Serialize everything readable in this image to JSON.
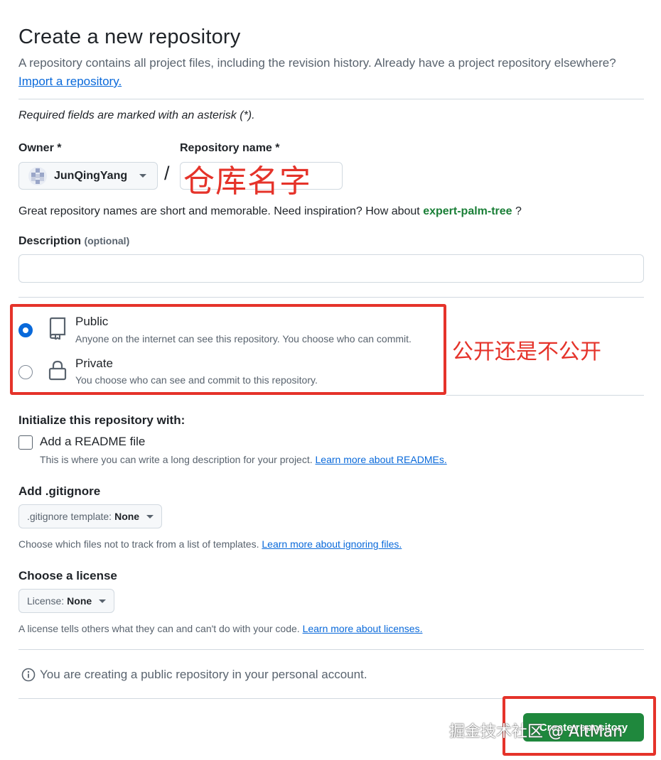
{
  "header": {
    "title": "Create a new repository",
    "subtitle": "A repository contains all project files, including the revision history. Already have a project repository elsewhere?",
    "import_link": "Import a repository."
  },
  "required_note": "Required fields are marked with an asterisk (*).",
  "owner": {
    "label": "Owner *",
    "value": "JunQingYang"
  },
  "separator": "/",
  "repository_name": {
    "label": "Repository name *",
    "value": "",
    "annotation": "仓库名字"
  },
  "inspiration": {
    "prefix": "Great repository names are short and memorable. Need inspiration? How about",
    "suggestion": "expert-palm-tree",
    "suffix": "?"
  },
  "description": {
    "label": "Description",
    "optional": "(optional)",
    "value": ""
  },
  "visibility": {
    "annotation": "公开还是不公开",
    "options": [
      {
        "title": "Public",
        "desc": "Anyone on the internet can see this repository. You choose who can commit.",
        "selected": true,
        "icon": "repo-icon"
      },
      {
        "title": "Private",
        "desc": "You choose who can see and commit to this repository.",
        "selected": false,
        "icon": "lock-icon"
      }
    ]
  },
  "initialize": {
    "title": "Initialize this repository with:",
    "readme_label": "Add a README file",
    "readme_checked": false,
    "readme_help": "This is where you can write a long description for your project.",
    "readme_link": "Learn more about READMEs."
  },
  "gitignore": {
    "title": "Add .gitignore",
    "select_prefix": ".gitignore template:",
    "select_value": "None",
    "help": "Choose which files not to track from a list of templates.",
    "link": "Learn more about ignoring files."
  },
  "license": {
    "title": "Choose a license",
    "select_prefix": "License:",
    "select_value": "None",
    "help": "A license tells others what they can and can't do with your code.",
    "link": "Learn more about licenses."
  },
  "info": {
    "text": "You are creating a public repository in your personal account.",
    "icon": "info-icon"
  },
  "submit": {
    "label": "Create repository"
  },
  "watermark": "掘金技术社区 @ AltMan",
  "colors": {
    "accent": "#0969da",
    "success": "#1f883d",
    "annotation": "#e5332a"
  }
}
